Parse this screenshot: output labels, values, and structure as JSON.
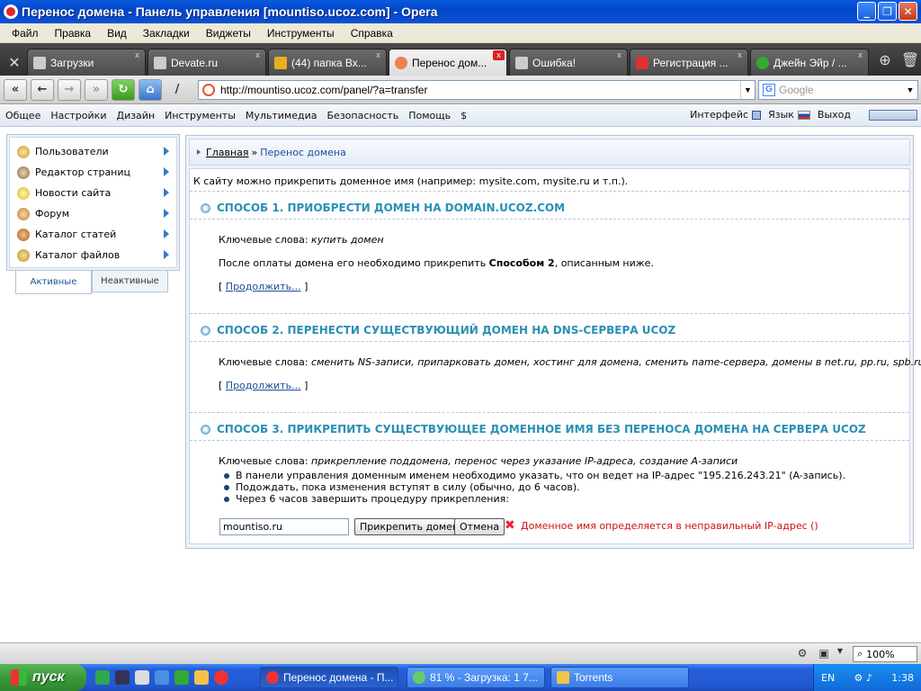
{
  "window": {
    "title": "Перенос домена - Панель управления [mountiso.ucoz.com] - Opera",
    "minimize": "_",
    "maximize": "❐",
    "close": "✕"
  },
  "menu": [
    "Файл",
    "Правка",
    "Вид",
    "Закладки",
    "Виджеты",
    "Инструменты",
    "Справка"
  ],
  "tabs": [
    {
      "label": "Загрузки",
      "active": false
    },
    {
      "label": "Devate.ru",
      "active": false
    },
    {
      "label": "(44) папка Вх...",
      "active": false
    },
    {
      "label": "Перенос дом...",
      "active": true
    },
    {
      "label": "Ошибка!",
      "active": false
    },
    {
      "label": "Регистрация ...",
      "active": false
    },
    {
      "label": "Джейн Эйр / ...",
      "active": false
    }
  ],
  "address": {
    "url": "http://mountiso.ucoz.com/panel/?a=transfer",
    "search_placeholder": "Google"
  },
  "panel_menu": {
    "items": [
      "Общее",
      "Настройки",
      "Дизайн",
      "Инструменты",
      "Мультимедиа",
      "Безопасность",
      "Помощь",
      "$"
    ],
    "interface": "Интерфейс",
    "language": "Язык",
    "logout": "Выход"
  },
  "sidebar": {
    "items": [
      {
        "label": "Пользователи"
      },
      {
        "label": "Редактор страниц"
      },
      {
        "label": "Новости сайта"
      },
      {
        "label": "Форум"
      },
      {
        "label": "Каталог статей"
      },
      {
        "label": "Каталог файлов"
      }
    ],
    "tab_active": "Активные",
    "tab_inactive": "Неактивные"
  },
  "breadcrumb": {
    "home": "Главная",
    "separator": "»",
    "current": "Перенос домена"
  },
  "content": {
    "intro": "К сайту можно прикрепить доменное имя (например: mysite.com, mysite.ru и т.п.).",
    "way1": {
      "title": "СПОСОБ 1. ПРИОБРЕСТИ ДОМЕН НА DOMAIN.UCOZ.COM",
      "keywords_label": "Ключевые слова:",
      "keywords": "купить домен",
      "text_before": "После оплаты домена его необходимо прикрепить",
      "text_bold": "Способом 2",
      "text_after": ", описанным ниже.",
      "continue": "Продолжить..."
    },
    "way2": {
      "title": "СПОСОБ 2. ПЕРЕНЕСТИ СУЩЕСТВУЮЩИЙ ДОМЕН НА DNS-СЕРВЕРА UCOZ",
      "keywords_label": "Ключевые слова:",
      "keywords": "сменить NS-записи, припарковать домен, хостинг для домена, сменить name-сервера, домены в net.ru, pp.ru, spb.ru и т.п.",
      "continue": "Продолжить..."
    },
    "way3": {
      "title": "СПОСОБ 3. ПРИКРЕПИТЬ СУЩЕСТВУЮЩЕЕ ДОМЕННОЕ ИМЯ БЕЗ ПЕРЕНОСА ДОМЕНА НА СЕРВЕРА UCOZ",
      "keywords_label": "Ключевые слова:",
      "keywords": "прикрепление поддомена, перенос через указание IP-адреса, создание A-записи",
      "steps": [
        "В панели управления доменным именем необходимо указать, что он ведет на IP-адрес \"195.216.243.21\" (A-запись).",
        "Подождать, пока изменения вступят в силу (обычно, до 6 часов).",
        "Через 6 часов завершить процедуру прикрепления:"
      ],
      "domain_value": "mountiso.ru",
      "attach_button": "Прикрепить домен",
      "cancel_button": "Отмена",
      "error": "Доменное имя определяется в неправильный IP-адрес ()"
    },
    "bracket_open": "[",
    "bracket_close": "]"
  },
  "status": {
    "zoom": "100%"
  },
  "taskbar": {
    "start": "пуск",
    "tasks": [
      {
        "label": "Перенос домена - П...",
        "active": true
      },
      {
        "label": "81 % - Загрузка: 1 7...",
        "active": false
      },
      {
        "label": "Torrents",
        "active": false
      }
    ],
    "lang": "EN",
    "time": "1:38"
  }
}
